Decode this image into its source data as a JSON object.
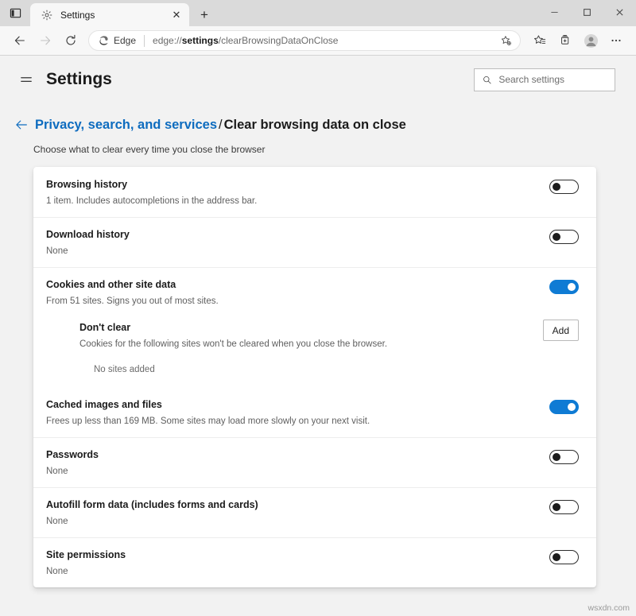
{
  "window": {
    "tab_search_icon": "vertical-tabs-icon",
    "tabs": [
      {
        "title": "Settings",
        "favicon": "gear-icon",
        "close_label": "✕"
      }
    ],
    "new_tab_label": "+",
    "controls": {
      "minimize": "—",
      "maximize": "☐",
      "close": "✕"
    }
  },
  "toolbar": {
    "back_label": "←",
    "forward_label": "→",
    "refresh_label": "↻",
    "edge_chip_label": "Edge",
    "url_prefix": "edge://",
    "url_bold": "settings",
    "url_suffix": "/clearBrowsingDataOnClose",
    "favorite_icon": "star-add-icon",
    "favorites_icon": "favorites-icon",
    "collections_icon": "collections-add-icon",
    "profile_icon": "profile-avatar-icon",
    "more_icon": "more-ellipsis-icon"
  },
  "settings": {
    "menu_icon": "hamburger-menu-icon",
    "title": "Settings",
    "search": {
      "icon": "search-icon",
      "placeholder": "Search settings",
      "value": ""
    },
    "back_icon": "back-arrow-icon",
    "breadcrumb": {
      "parent": "Privacy, search, and services",
      "separator": "/",
      "current": "Clear browsing data on close"
    },
    "subtitle": "Choose what to clear every time you close the browser",
    "rows": [
      {
        "title": "Browsing history",
        "desc": "1 item. Includes autocompletions in the address bar.",
        "toggle": "off"
      },
      {
        "title": "Download history",
        "desc": "None",
        "toggle": "off"
      },
      {
        "title": "Cookies and other site data",
        "desc": "From 51 sites. Signs you out of most sites.",
        "toggle": "on"
      },
      {
        "title": "Cached images and files",
        "desc": "Frees up less than 169 MB. Some sites may load more slowly on your next visit.",
        "toggle": "on"
      },
      {
        "title": "Passwords",
        "desc": "None",
        "toggle": "off"
      },
      {
        "title": "Autofill form data (includes forms and cards)",
        "desc": "None",
        "toggle": "off"
      },
      {
        "title": "Site permissions",
        "desc": "None",
        "toggle": "off"
      }
    ],
    "dont_clear": {
      "title": "Don't clear",
      "desc": "Cookies for the following sites won't be cleared when you close the browser.",
      "add_label": "Add",
      "empty_note": "No sites added"
    }
  },
  "watermark": "wsxdn.com",
  "colors": {
    "accent": "#0f7bd4",
    "link": "#0e6cbf",
    "page_bg": "#f2f2f2",
    "card_bg": "#ffffff"
  }
}
